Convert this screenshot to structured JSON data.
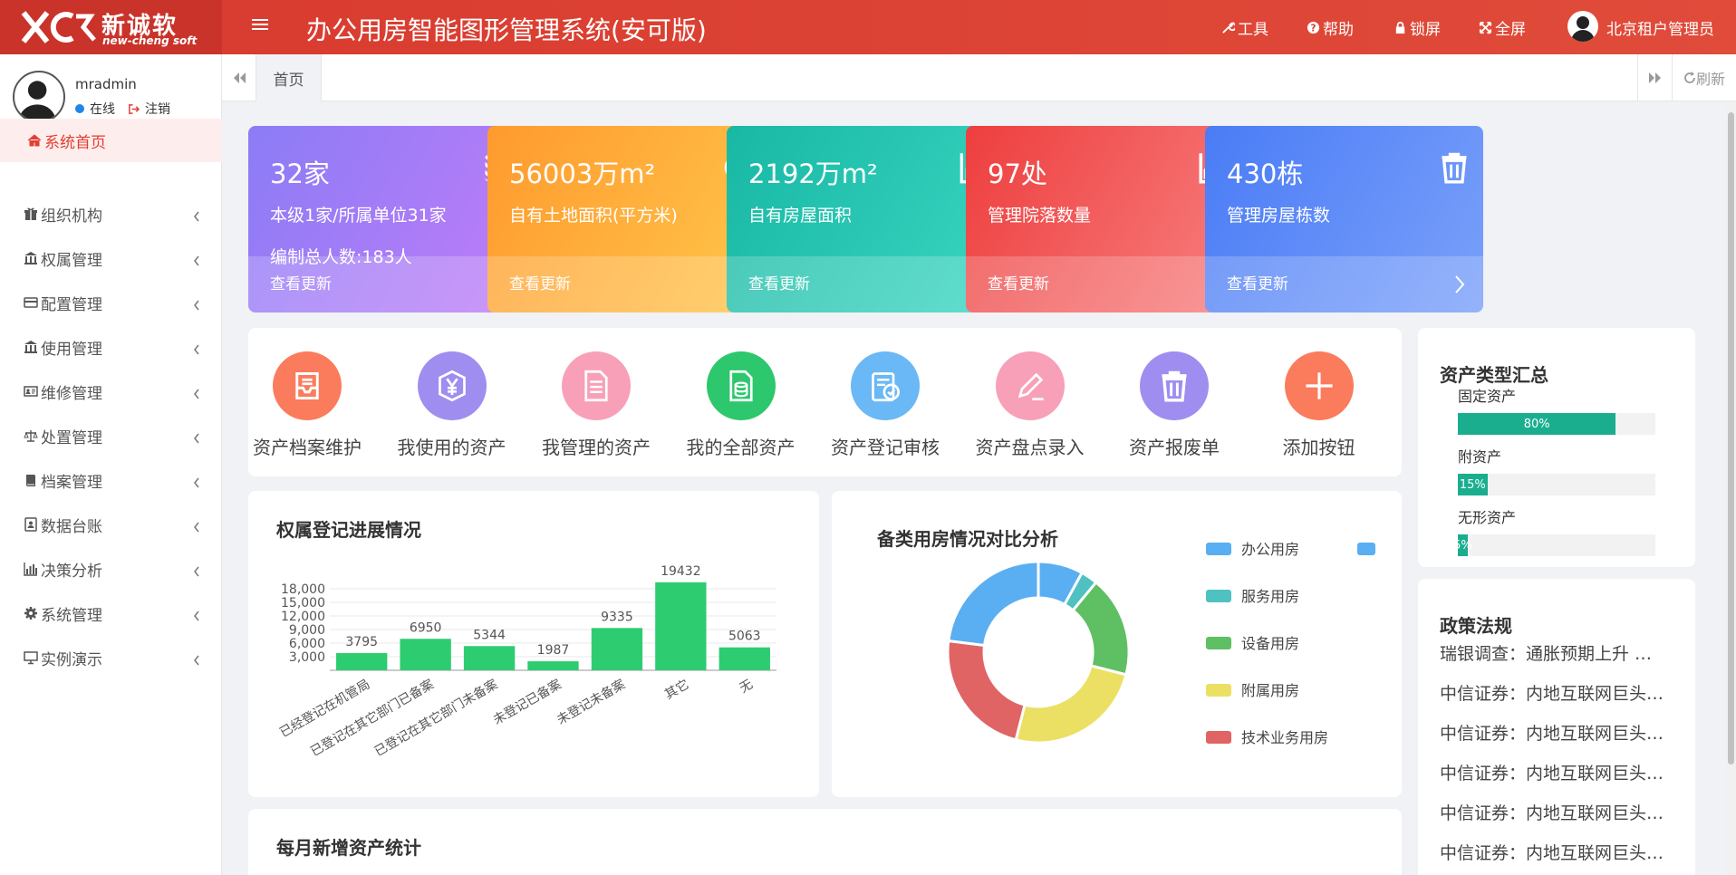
{
  "logo": {
    "cn": "新诚软",
    "en": "new-cheng soft"
  },
  "app_title": "办公用房智能图形管理系统(安可版)",
  "top_links": {
    "tools": "工具",
    "help": "帮助",
    "lock": "锁屏",
    "fullscreen": "全屏"
  },
  "top_user": "北京租户管理员",
  "sidebar": {
    "username": "mradmin",
    "status": "在线",
    "logout": "注销",
    "items": [
      {
        "label": "系统首页",
        "icon": "home-icon"
      },
      {
        "label": "组织机构",
        "icon": "gift-icon"
      },
      {
        "label": "权属管理",
        "icon": "bank-icon"
      },
      {
        "label": "配置管理",
        "icon": "card-icon"
      },
      {
        "label": "使用管理",
        "icon": "bank-icon"
      },
      {
        "label": "维修管理",
        "icon": "idcard-icon"
      },
      {
        "label": "处置管理",
        "icon": "scale-icon"
      },
      {
        "label": "档案管理",
        "icon": "book-icon"
      },
      {
        "label": "数据台账",
        "icon": "contact-icon"
      },
      {
        "label": "决策分析",
        "icon": "bar-chart-icon"
      },
      {
        "label": "系统管理",
        "icon": "gear-icon"
      },
      {
        "label": "实例演示",
        "icon": "desktop-icon"
      }
    ]
  },
  "tabs": {
    "home": "首页",
    "refresh": "刷新"
  },
  "stats": [
    {
      "value": "32家",
      "label": "本级1家/所属单位31家",
      "sub": "编制总人数:183人",
      "more": "查看更新",
      "icon": "database-icon",
      "color_from": "#8b7cf6",
      "color_to": "#c07cf8"
    },
    {
      "value": "56003万m²",
      "label": "自有土地面积(平方米)",
      "sub": "",
      "more": "查看更新",
      "icon": "pie-icon",
      "color_from": "#ff9a2e",
      "color_to": "#ffc64a"
    },
    {
      "value": "2192万m²",
      "label": "自有房屋面积",
      "sub": "",
      "more": "查看更新",
      "icon": "bar-chart-icon",
      "color_from": "#18b8a4",
      "color_to": "#3ad6c2"
    },
    {
      "value": "97处",
      "label": "管理院落数量",
      "sub": "",
      "more": "查看更新",
      "icon": "area-chart-icon",
      "color_from": "#ee3e3e",
      "color_to": "#f88080"
    },
    {
      "value": "430栋",
      "label": "管理房屋栋数",
      "sub": "",
      "more": "查看更新",
      "icon": "trash-icon",
      "color_from": "#4a7cf6",
      "color_to": "#7aa0fa"
    }
  ],
  "quick_actions": [
    {
      "label": "资产档案维护",
      "color": "#fa7c5c",
      "icon": "inbox-icon"
    },
    {
      "label": "我使用的资产",
      "color": "#9f8ef0",
      "icon": "yen-shield-icon"
    },
    {
      "label": "我管理的资产",
      "color": "#f8a0b8",
      "icon": "document-icon"
    },
    {
      "label": "我的全部资产",
      "color": "#2dc76d",
      "icon": "file-db-icon"
    },
    {
      "label": "资产登记审核",
      "color": "#6ab8f5",
      "icon": "clipboard-check-icon"
    },
    {
      "label": "资产盘点录入",
      "color": "#f8a0b8",
      "icon": "pen-icon"
    },
    {
      "label": "资产报废单",
      "color": "#9f8ef0",
      "icon": "trash-icon"
    },
    {
      "label": "添加按钮",
      "color": "#fa7c5c",
      "icon": "plus-icon"
    }
  ],
  "asset_types": {
    "title": "资产类型汇总",
    "items": [
      {
        "name": "固定资产",
        "percent": 80,
        "label": "80%"
      },
      {
        "name": "附资产",
        "percent": 15,
        "label": "15%"
      },
      {
        "name": "无形资产",
        "percent": 5,
        "label": "5%"
      }
    ]
  },
  "policy": {
    "title": "政策法规",
    "items": [
      "瑞银调查：通胀预期上升 …",
      "中信证券：内地互联网巨头…",
      "中信证券：内地互联网巨头…",
      "中信证券：内地互联网巨头…",
      "中信证券：内地互联网巨头…",
      "中信证券：内地互联网巨头…"
    ]
  },
  "monthly_title": "每月新增资产统计",
  "chart_data": [
    {
      "type": "bar",
      "title": "权属登记进展情况",
      "categories": [
        "已经登记在机管局",
        "已登记在其它部门已备案",
        "已登记在其它部门未备案",
        "未登记已备案",
        "未登记未备案",
        "其它",
        "无"
      ],
      "values": [
        3795,
        6950,
        5344,
        1987,
        9335,
        19432,
        5063
      ],
      "yticks": [
        "3,000",
        "6,000",
        "9,000",
        "12,000",
        "15,000",
        "18,000"
      ],
      "ylim": [
        0,
        20000
      ],
      "color": "#2ecc71",
      "grid": true
    },
    {
      "type": "pie",
      "title": "备类用房情况对比分析",
      "categories": [
        "办公用房",
        "服务用房",
        "设备用房",
        "附属用房",
        "技术业务用房"
      ],
      "series_colors": [
        "#5aaef2",
        "#4fc1c1",
        "#5fbf63",
        "#ebe063",
        "#e06464"
      ],
      "values": [
        8,
        3,
        18,
        25,
        23,
        23
      ],
      "slice_colors": [
        "#5aaef2",
        "#4fc1c1",
        "#5fbf63",
        "#ebe063",
        "#e06464",
        "#5aaef2"
      ],
      "donut": true,
      "legend": "right"
    }
  ]
}
